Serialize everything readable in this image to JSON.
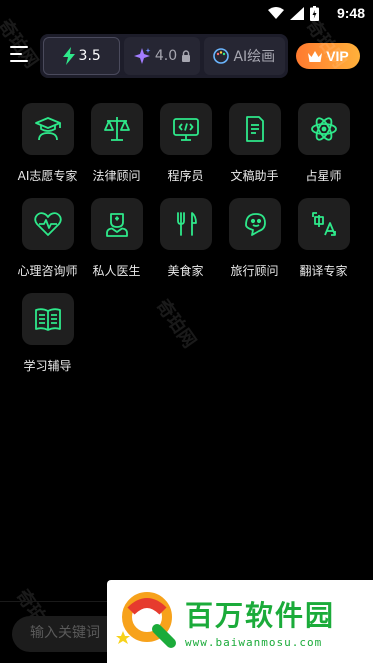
{
  "status": {
    "time": "9:48"
  },
  "toolbar": {
    "models": [
      {
        "label": "3.5"
      },
      {
        "label": "4.0"
      },
      {
        "label": "AI绘画"
      }
    ],
    "vip_label": "VIP"
  },
  "tiles": [
    {
      "label": "AI志愿专家",
      "icon": "graduate-icon"
    },
    {
      "label": "法律顾问",
      "icon": "scales-icon"
    },
    {
      "label": "程序员",
      "icon": "code-icon"
    },
    {
      "label": "文稿助手",
      "icon": "document-icon"
    },
    {
      "label": "占星师",
      "icon": "atom-icon"
    },
    {
      "label": "心理咨询师",
      "icon": "heart-pulse-icon"
    },
    {
      "label": "私人医生",
      "icon": "doctor-icon"
    },
    {
      "label": "美食家",
      "icon": "cutlery-icon"
    },
    {
      "label": "旅行顾问",
      "icon": "travel-icon"
    },
    {
      "label": "翻译专家",
      "icon": "translate-icon"
    },
    {
      "label": "学习辅导",
      "icon": "book-icon"
    }
  ],
  "search": {
    "placeholder": "输入关键词"
  },
  "watermark": "奇珀网",
  "brand": {
    "name": "百万软件园",
    "url": "www.baiwanmosu.com"
  },
  "colors": {
    "accent": "#2ee88a",
    "vip": "#ff8c33",
    "brand_green": "#1bab3a"
  }
}
